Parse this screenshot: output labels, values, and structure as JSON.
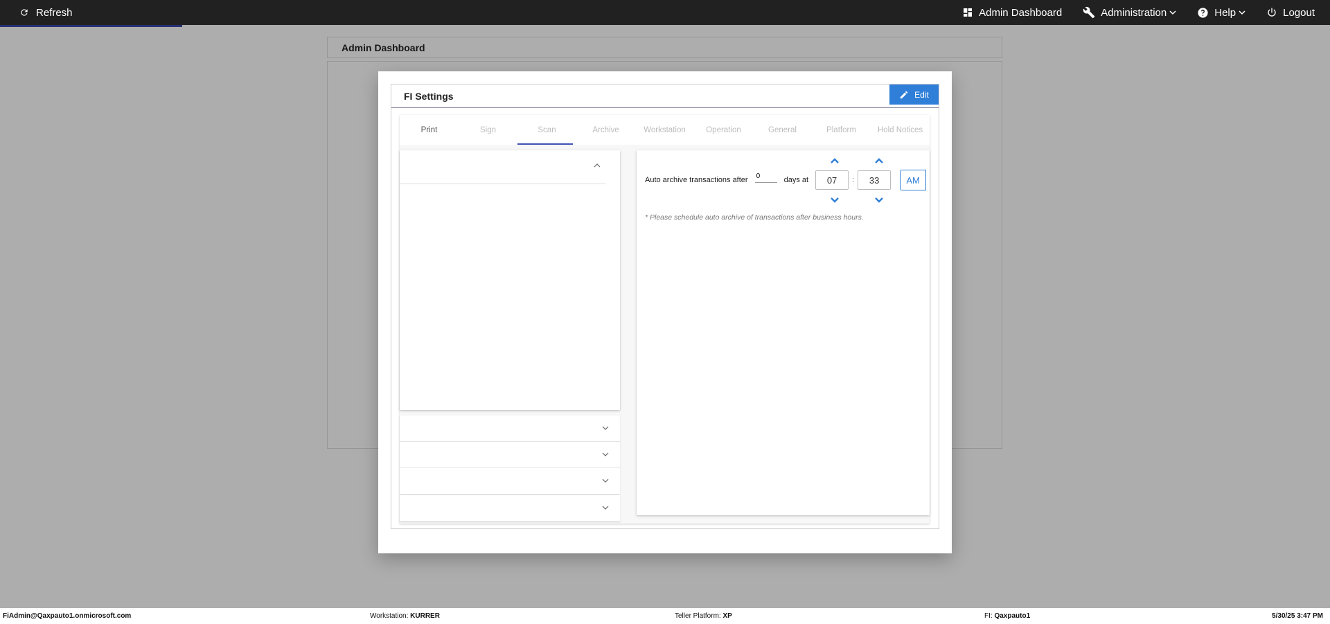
{
  "topbar": {
    "refresh_label": "Refresh",
    "nav": {
      "admin_dashboard": "Admin Dashboard",
      "administration": "Administration",
      "help": "Help",
      "logout": "Logout"
    }
  },
  "page": {
    "header_title": "Admin Dashboard"
  },
  "modal": {
    "title": "FI Settings",
    "edit_label": "Edit",
    "tabs": [
      "Print",
      "Sign",
      "Scan",
      "Archive",
      "Workstation",
      "Operation",
      "General",
      "Platform",
      "Hold Notices"
    ],
    "archive": {
      "label_before": "Auto archive transactions after",
      "days_value": "0",
      "label_after": "days at",
      "hour": "07",
      "colon": ":",
      "minute": "33",
      "meridiem": "AM",
      "note": "* Please schedule auto archive of transactions after business hours."
    }
  },
  "statusbar": {
    "user": "FiAdmin@Qaxpauto1.onmicrosoft.com",
    "workstation_label": "Workstation:",
    "workstation_value": "KURRER",
    "platform_label": "Teller Platform:",
    "platform_value": "XP",
    "fi_label": "FI:",
    "fi_value": "Qaxpauto1",
    "datetime": "5/30/25 3:47 PM"
  },
  "colors": {
    "accent": "#2f7fd8",
    "topbar": "#212121",
    "tab_indicator": "#3f51b5"
  }
}
